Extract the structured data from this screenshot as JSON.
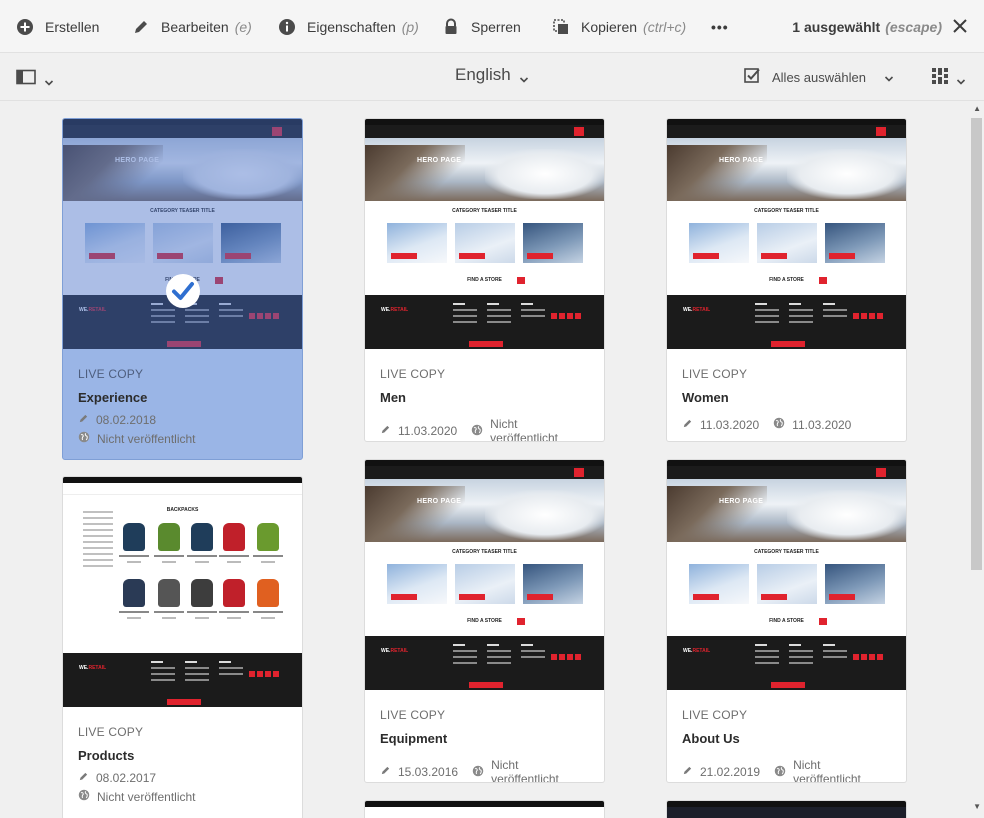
{
  "actionbar": {
    "create": "Erstellen",
    "edit": "Bearbeiten",
    "edit_hint": "(e)",
    "properties": "Eigenschaften",
    "properties_hint": "(p)",
    "lock": "Sperren",
    "copy": "Kopieren",
    "copy_hint": "(ctrl+c)",
    "more": "•••",
    "selection": "1 ausgewählt",
    "selection_hint": "(escape)"
  },
  "subbar": {
    "language": "English",
    "select_all": "Alles auswählen"
  },
  "colors": {
    "accent_red": "#e0232e",
    "selected_card": "#9ab5e6"
  },
  "cards": [
    {
      "kind": "LIVE COPY",
      "title": "Experience",
      "modified": "08.02.2018",
      "status": "Nicht veröffentlicht",
      "selected": true,
      "thumb": "hero",
      "hero_title": "HERO PAGE",
      "cat_title": "CATEGORY TEASER TITLE",
      "find": "FIND A STORE"
    },
    {
      "kind": "LIVE COPY",
      "title": "Men",
      "modified": "11.03.2020",
      "status": "Nicht veröffentlicht",
      "selected": false,
      "thumb": "hero",
      "hero_title": "HERO PAGE",
      "cat_title": "CATEGORY TEASER TITLE",
      "find": "FIND A STORE"
    },
    {
      "kind": "LIVE COPY",
      "title": "Women",
      "modified": "11.03.2020",
      "status": "11.03.2020",
      "selected": false,
      "thumb": "hero",
      "hero_title": "HERO PAGE",
      "cat_title": "CATEGORY TEASER TITLE",
      "find": "FIND A STORE"
    },
    {
      "kind": "LIVE COPY",
      "title": "Products",
      "modified": "08.02.2017",
      "status": "Nicht veröffentlicht",
      "selected": false,
      "thumb": "products",
      "products_title": "BACKPACKS"
    },
    {
      "kind": "LIVE COPY",
      "title": "Equipment",
      "modified": "15.03.2016",
      "status": "Nicht veröffentlicht",
      "selected": false,
      "thumb": "hero",
      "hero_title": "HERO PAGE",
      "cat_title": "CATEGORY TEASER TITLE",
      "find": "FIND A STORE"
    },
    {
      "kind": "LIVE COPY",
      "title": "About Us",
      "modified": "21.02.2019",
      "status": "Nicht veröffentlicht",
      "selected": false,
      "thumb": "hero",
      "hero_title": "HERO PAGE",
      "cat_title": "CATEGORY TEASER TITLE",
      "find": "FIND A STORE"
    }
  ],
  "icons": {
    "create": "plus-circle-icon",
    "edit": "pencil-icon",
    "properties": "info-icon",
    "lock": "lock-icon",
    "copy": "copy-icon",
    "close": "close-icon",
    "rail": "rail-toggle-icon",
    "select_all": "checkbox-icon",
    "view": "view-switcher-icon",
    "selected_check": "checkmark-circle-icon",
    "modified": "pencil-icon",
    "publish": "globe-icon"
  }
}
